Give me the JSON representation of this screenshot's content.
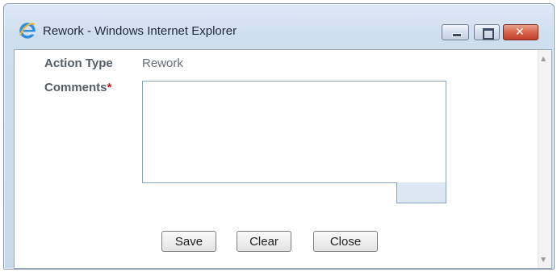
{
  "window": {
    "title": "Rework - Windows Internet Explorer",
    "app_icon": "internet-explorer-icon",
    "controls": [
      "minimize-icon",
      "maximize-icon",
      "close-icon"
    ]
  },
  "form": {
    "action_type_label": "Action Type",
    "action_type_value": "Rework",
    "comments_label": "Comments",
    "required_marker": "*",
    "comments_value": ""
  },
  "buttons": {
    "save": "Save",
    "clear": "Clear",
    "close": "Close"
  },
  "colors": {
    "required": "#cc1c1c",
    "label": "#555d66",
    "close_button": "#d8624a"
  }
}
